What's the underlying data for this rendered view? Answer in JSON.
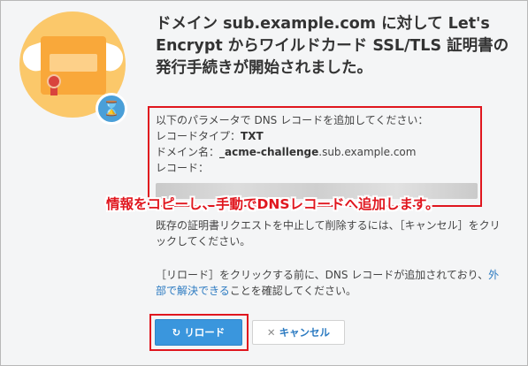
{
  "dialog": {
    "title": "ドメイン sub.example.com に対して Let's Encrypt からワイルドカード SSL/TLS 証明書の発行手続きが開始されました。"
  },
  "info": {
    "intro": "以下のパラメータで DNS レコードを追加してください：",
    "record_type_label": "レコードタイプ：",
    "record_type_value": "TXT",
    "domain_label": "ドメイン名：",
    "domain_value_prefix": "_acme-challenge",
    "domain_value_suffix": ".sub.example.com",
    "record_label": "レコード："
  },
  "callout": "情報をコピーし、手動でDNSレコードへ追加します。",
  "paragraph_cancel": "既存の証明書リクエストを中止して削除するには、［キャンセル］をクリックしてください。",
  "paragraph_reload": {
    "before": "［リロード］をクリックする前に、DNS レコードが追加されており、",
    "link": "外部で解決できる",
    "after": "ことを確認してください。"
  },
  "buttons": {
    "reload_icon": "↻",
    "reload_label": "リロード",
    "cancel_icon": "✕",
    "cancel_label": "キャンセル"
  },
  "icons": {
    "illustration": "certificate-with-wings-icon",
    "status": "hourglass-icon"
  },
  "colors": {
    "highlight": "#e0161e",
    "primary_button": "#3a96dd",
    "link": "#2b7ac1",
    "illustration_bg": "#fbc86a"
  }
}
